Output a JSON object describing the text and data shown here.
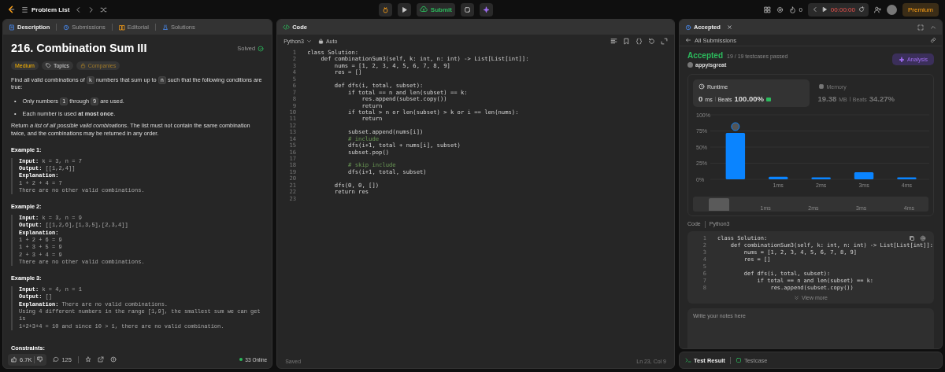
{
  "topbar": {
    "title": "Problem List",
    "submit": "Submit",
    "streak": "0",
    "timer": "00:00:00",
    "premium": "Premium"
  },
  "left_panel": {
    "tabs": [
      {
        "label": "Description",
        "selected": true
      },
      {
        "label": "Submissions",
        "selected": false
      },
      {
        "label": "Editorial",
        "selected": false
      },
      {
        "label": "Solutions",
        "selected": false
      }
    ],
    "title": "216. Combination Sum III",
    "status": "Solved",
    "tags": [
      {
        "label": "Medium",
        "kind": "difficulty"
      },
      {
        "label": "Topics",
        "kind": "topic"
      },
      {
        "label": "Companies",
        "kind": "locked"
      }
    ],
    "intro": [
      {
        "kind": "text",
        "text": "Find all valid combinations of "
      },
      {
        "kind": "code",
        "text": "k"
      },
      {
        "kind": "text",
        "text": " numbers that sum up to "
      },
      {
        "kind": "code",
        "text": "n"
      },
      {
        "kind": "text",
        "text": " such that the following conditions are true:"
      }
    ],
    "bullets": [
      {
        "marker": "•",
        "parts": [
          {
            "kind": "text",
            "text": "Only numbers "
          },
          {
            "kind": "code",
            "text": "1"
          },
          {
            "kind": "text",
            "text": " through "
          },
          {
            "kind": "code",
            "text": "9"
          },
          {
            "kind": "text",
            "text": " are used."
          }
        ]
      },
      {
        "marker": "•",
        "parts": [
          {
            "kind": "text",
            "text": "Each number is used **at most once**."
          }
        ]
      }
    ],
    "outro": [
      {
        "kind": "text",
        "text": "Return *a list of all possible valid combinations*. The list must not contain the same combination twice, and the combinations may be returned in any order."
      }
    ],
    "examples": [
      {
        "heading": "Example 1:",
        "lines": [
          "**Input:** k = 3, n = 7",
          "**Output:** [[1,2,4]]",
          "**Explanation:**",
          "1 + 2 + 4 = 7",
          "There are no other valid combinations."
        ]
      },
      {
        "heading": "Example 2:",
        "lines": [
          "**Input:** k = 3, n = 9",
          "**Output:** [[1,2,6],[1,3,5],[2,3,4]]",
          "**Explanation:**",
          "1 + 2 + 6 = 9",
          "1 + 3 + 5 = 9",
          "2 + 3 + 4 = 9",
          "There are no other valid combinations."
        ]
      },
      {
        "heading": "Example 3:",
        "lines": [
          "**Input:** k = 4, n = 1",
          "**Output:** []",
          "**Explanation:** There are no valid combinations.",
          "Using 4 different numbers in the range [1,9], the smallest sum we can get is",
          "1+2+3+4 = 10 and since 10 > 1, there are no valid combination."
        ]
      }
    ],
    "constraints_heading": "Constraints:",
    "footer": {
      "likes": "6.7K",
      "comments": "125",
      "online": "33 Online"
    }
  },
  "editor": {
    "tab": "Code",
    "language": "Python3",
    "mode": "Auto",
    "status": "Saved",
    "cursor": "Ln 23, Col 9",
    "lines": [
      {
        "no": "1",
        "code": "class Solution:",
        "kind": "code"
      },
      {
        "no": "2",
        "code": "    def combinationSum3(self, k: int, n: int) -> List[List[int]]:",
        "kind": "code"
      },
      {
        "no": "3",
        "code": "        nums = [1, 2, 3, 4, 5, 6, 7, 8, 9]",
        "kind": "code"
      },
      {
        "no": "4",
        "code": "        res = []",
        "kind": "code"
      },
      {
        "no": "5"
      },
      {
        "no": "6",
        "code": "        def dfs(i, total, subset):",
        "kind": "code"
      },
      {
        "no": "7",
        "code": "            if total == n and len(subset) == k:",
        "kind": "code"
      },
      {
        "no": "8",
        "code": "                res.append(subset.copy())",
        "kind": "code"
      },
      {
        "no": "9",
        "code": "                return",
        "kind": "code"
      },
      {
        "no": "10",
        "code": "            if total > n or len(subset) > k or i == len(nums):",
        "kind": "code"
      },
      {
        "no": "11",
        "code": "                return",
        "kind": "code"
      },
      {
        "no": "12"
      },
      {
        "no": "13",
        "code": "            subset.append(nums[i])",
        "kind": "code"
      },
      {
        "no": "14",
        "code": "            # include",
        "kind": "comment"
      },
      {
        "no": "15",
        "code": "            dfs(i+1, total + nums[i], subset)",
        "kind": "code"
      },
      {
        "no": "16",
        "code": "            subset.pop()",
        "kind": "code"
      },
      {
        "no": "17"
      },
      {
        "no": "18",
        "code": "            # skip include",
        "kind": "comment"
      },
      {
        "no": "19",
        "code": "            dfs(i+1, total, subset)",
        "kind": "code"
      },
      {
        "no": "20"
      },
      {
        "no": "21",
        "code": "        dfs(0, 0, [])",
        "kind": "code"
      },
      {
        "no": "22",
        "code": "        return res",
        "kind": "code"
      },
      {
        "no": "23"
      }
    ]
  },
  "result_panel": {
    "tab": "Accepted",
    "back": "All Submissions",
    "status": "Accepted",
    "testcases": "19 / 19 testcases passed",
    "user": "appyisgreat",
    "analysis": "Analysis",
    "stats": [
      {
        "label": "Runtime",
        "value": "0",
        "unit": "ms",
        "beats_label": "Beats",
        "beats": "100.00%",
        "selected": true
      },
      {
        "label": "Memory",
        "value": "19.38",
        "unit": "MB",
        "beats_label": "Beats",
        "beats": "34.27%",
        "selected": false
      }
    ],
    "chart_data": {
      "type": "bar",
      "categories": [
        null,
        "1ms",
        "2ms",
        "3ms",
        "4ms"
      ],
      "values": [
        72,
        4,
        3,
        11,
        3
      ],
      "ylim": [
        0,
        100
      ],
      "yticks": [
        {
          "value": 0,
          "label": "0%"
        },
        {
          "value": 25,
          "label": "25%"
        },
        {
          "value": 50,
          "label": "50%"
        },
        {
          "value": 75,
          "label": "75%"
        },
        {
          "value": 100,
          "label": "100%"
        }
      ]
    },
    "range_labels": [
      "1ms",
      "2ms",
      "3ms",
      "4ms"
    ],
    "code_label": "Code",
    "code_language": "Python3",
    "code_lines": [
      {
        "no": "1",
        "code": "class Solution:"
      },
      {
        "no": "2",
        "code": "    def combinationSum3(self, k: int, n: int) -> List[List[int]]:"
      },
      {
        "no": "3",
        "code": "        nums = [1, 2, 3, 4, 5, 6, 7, 8, 9]"
      },
      {
        "no": "4",
        "code": "        res = []"
      },
      {
        "no": "5"
      },
      {
        "no": "6",
        "code": "        def dfs(i, total, subset):"
      },
      {
        "no": "7",
        "code": "            if total == n and len(subset) == k:"
      },
      {
        "no": "8",
        "code": "                res.append(subset.copy())"
      }
    ],
    "view_more": "View more",
    "notes_placeholder": "Write your notes here"
  },
  "bottom_panel": {
    "tabs": [
      {
        "label": "Test Result",
        "selected": true
      },
      {
        "label": "Testcase",
        "selected": false
      }
    ]
  }
}
